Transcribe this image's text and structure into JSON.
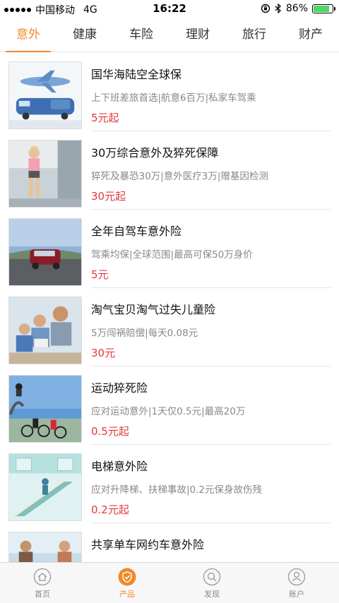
{
  "status_bar": {
    "carrier": "中国移动",
    "network": "4G",
    "time": "16:22",
    "battery": "86%",
    "battery_level": 0.86
  },
  "tabs": [
    {
      "label": "意外",
      "active": true
    },
    {
      "label": "健康",
      "active": false
    },
    {
      "label": "车险",
      "active": false
    },
    {
      "label": "理财",
      "active": false
    },
    {
      "label": "旅行",
      "active": false
    },
    {
      "label": "财产",
      "active": false
    }
  ],
  "products": [
    {
      "title": "国华海陆空全球保",
      "desc": "上下班差旅首选|航意6百万|私家车驾乘",
      "price": "5元起"
    },
    {
      "title": "30万综合意外及猝死保障",
      "desc": "猝死及暴恐30万|意外医疗3万|赠基因检测",
      "price": "30元起"
    },
    {
      "title": "全年自驾车意外险",
      "desc": "驾乘均保|全球范围|最高可保50万身价",
      "price": "5元"
    },
    {
      "title": "淘气宝贝淘气过失儿童险",
      "desc": "5万闯祸赔偿|每天0.08元",
      "price": "30元"
    },
    {
      "title": "运动猝死险",
      "desc": "应对运动意外|1天仅0.5元|最高20万",
      "price": "0.5元起"
    },
    {
      "title": "电梯意外险",
      "desc": "应对升降梯、扶梯事故|0.2元保身故伤残",
      "price": "0.2元起"
    },
    {
      "title": "共享单车网约车意外险",
      "desc": "",
      "price": ""
    }
  ],
  "bottom_nav": [
    {
      "label": "首页",
      "icon": "home-icon",
      "active": false
    },
    {
      "label": "产品",
      "icon": "shield-icon",
      "active": true
    },
    {
      "label": "发现",
      "icon": "discover-icon",
      "active": false
    },
    {
      "label": "账户",
      "icon": "account-icon",
      "active": false
    }
  ],
  "colors": {
    "accent": "#f08a2a",
    "price": "#e4393c",
    "muted": "#888888"
  }
}
